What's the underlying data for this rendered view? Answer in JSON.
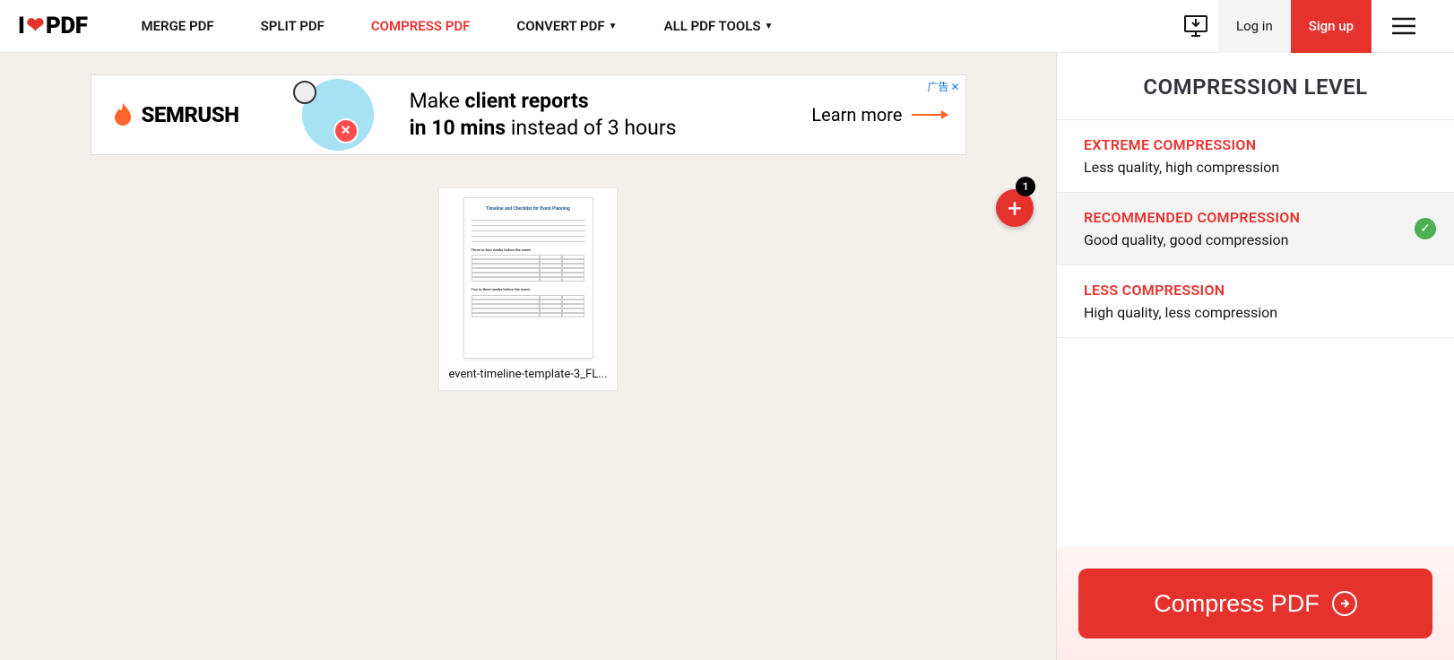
{
  "logo": {
    "part1": "I",
    "part2": "PDF"
  },
  "nav": {
    "merge": "MERGE PDF",
    "split": "SPLIT PDF",
    "compress": "COMPRESS PDF",
    "convert": "CONVERT PDF",
    "all_tools": "ALL PDF TOOLS"
  },
  "header": {
    "login": "Log in",
    "signup": "Sign up"
  },
  "ad": {
    "brand": "SEMRUSH",
    "line1_pre": "Make ",
    "line1_bold": "client reports",
    "line2_bold": "in 10 mins ",
    "line2_post": "instead of 3 hours",
    "cta": "Learn more",
    "close_label": "广告",
    "close_x": "✕"
  },
  "file": {
    "name": "event-timeline-template-3_FL..."
  },
  "add_button": {
    "count": "1"
  },
  "panel": {
    "title": "COMPRESSION LEVEL",
    "options": [
      {
        "title": "EXTREME COMPRESSION",
        "desc": "Less quality, high compression",
        "selected": false
      },
      {
        "title": "RECOMMENDED COMPRESSION",
        "desc": "Good quality, good compression",
        "selected": true
      },
      {
        "title": "LESS COMPRESSION",
        "desc": "High quality, less compression",
        "selected": false
      }
    ]
  },
  "action": {
    "label": "Compress PDF"
  }
}
